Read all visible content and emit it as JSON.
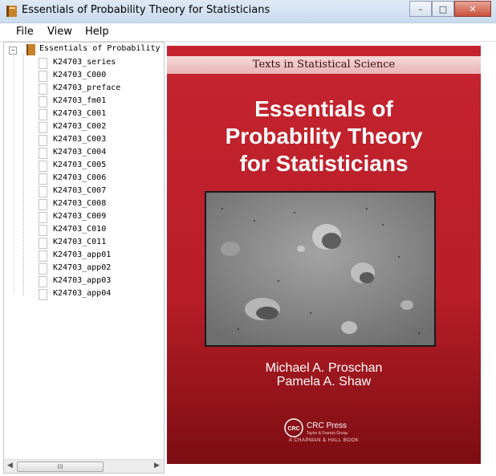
{
  "window": {
    "title": "Essentials of Probability Theory for Statisticians",
    "controls": {
      "minimize": "–",
      "maximize": "□",
      "close": "✕"
    }
  },
  "menu": [
    "File",
    "View",
    "Help"
  ],
  "tree": {
    "root_label": "Essentials of Probability",
    "expander": "−",
    "items": [
      "K24703_series",
      "K24703_C000",
      "K24703_preface",
      "K24703_fm01",
      "K24703_C001",
      "K24703_C002",
      "K24703_C003",
      "K24703_C004",
      "K24703_C005",
      "K24703_C006",
      "K24703_C007",
      "K24703_C008",
      "K24703_C009",
      "K24703_C010",
      "K24703_C011",
      "K24703_app01",
      "K24703_app02",
      "K24703_app03",
      "K24703_app04"
    ],
    "scroll": {
      "left": "◀",
      "right": "▶",
      "grip": "III"
    }
  },
  "cover": {
    "series": "Texts in Statistical Science",
    "title_lines": [
      "Essentials of",
      "Probability Theory",
      "for Statisticians"
    ],
    "authors": [
      "Michael A. Proschan",
      "Pamela A. Shaw"
    ],
    "publisher": "CRC Press",
    "publisher_sub": "Taylor & Francis Group",
    "logo_text": "CRC",
    "imprint": "A CHAPMAN & HALL BOOK"
  },
  "colors": {
    "cover_red": "#c5242f",
    "band": "#ecc0c0"
  }
}
